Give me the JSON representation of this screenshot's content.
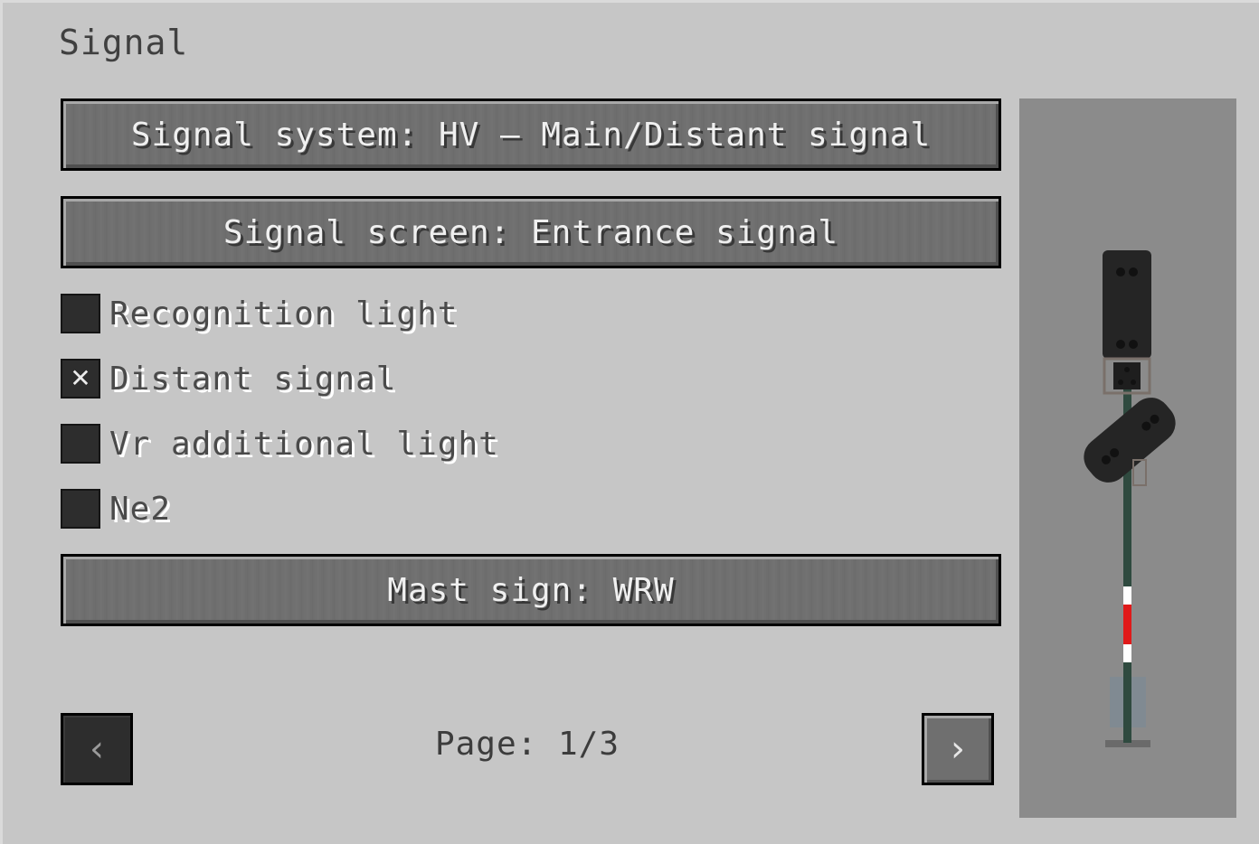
{
  "screen": {
    "title": "Signal"
  },
  "buttons": {
    "signal_system": "Signal system: HV – Main/Distant signal",
    "signal_screen": "Signal screen: Entrance signal",
    "mast_sign": "Mast sign: WRW"
  },
  "options": [
    {
      "label": "Recognition light",
      "checked": false,
      "mark": ""
    },
    {
      "label": "Distant signal",
      "checked": true,
      "mark": "✕"
    },
    {
      "label": "Vr additional light",
      "checked": false,
      "mark": ""
    },
    {
      "label": "Ne2",
      "checked": false,
      "mark": ""
    }
  ],
  "pagination": {
    "label": "Page: 1/3",
    "prev_icon": "chevron-left-icon",
    "next_icon": "chevron-right-icon",
    "prev_glyph": "‹",
    "next_glyph": "›"
  },
  "preview": {
    "description_icon": "signal-model-preview",
    "mast_color": "#2f4a3f",
    "head_color": "#252525",
    "stripe_red": "#e01a1a",
    "stripe_white": "#ffffff"
  }
}
